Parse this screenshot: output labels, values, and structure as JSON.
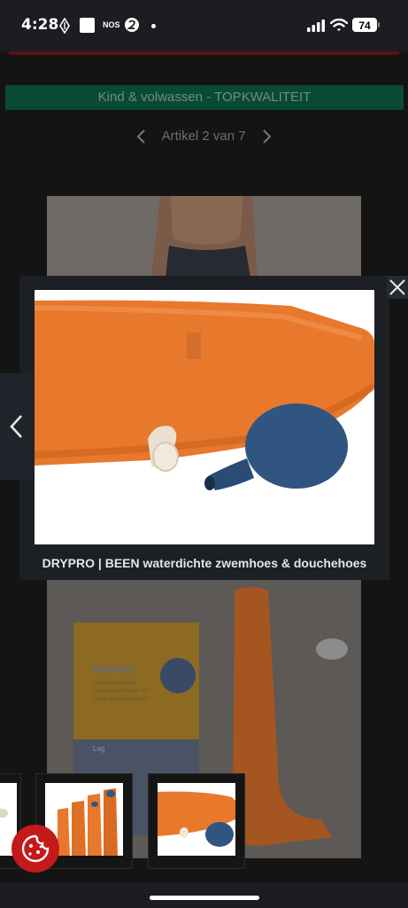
{
  "status_bar": {
    "time": "4:28",
    "nos_label": "NOS",
    "battery": "74"
  },
  "page": {
    "banner": "Kind & volwassen - TOPKWALITEIT",
    "pager_label": "Artikel 2 van 7"
  },
  "lightbox": {
    "caption": "DRYPRO | BEEN waterdichte zwemhoes & douchehoes",
    "close_icon": "close-icon",
    "prev_icon": "chevron-left-icon"
  },
  "box_print": {
    "brand": "DRYPRO",
    "tagline": "Vacuum-sealed waterproof cover for casts and bandages",
    "leg_label": "Leg"
  },
  "colors": {
    "orange": "#e8782c",
    "blue_bulb": "#2f5580",
    "banner_green": "#0a4a34",
    "cookie_red": "#c41a1a"
  }
}
